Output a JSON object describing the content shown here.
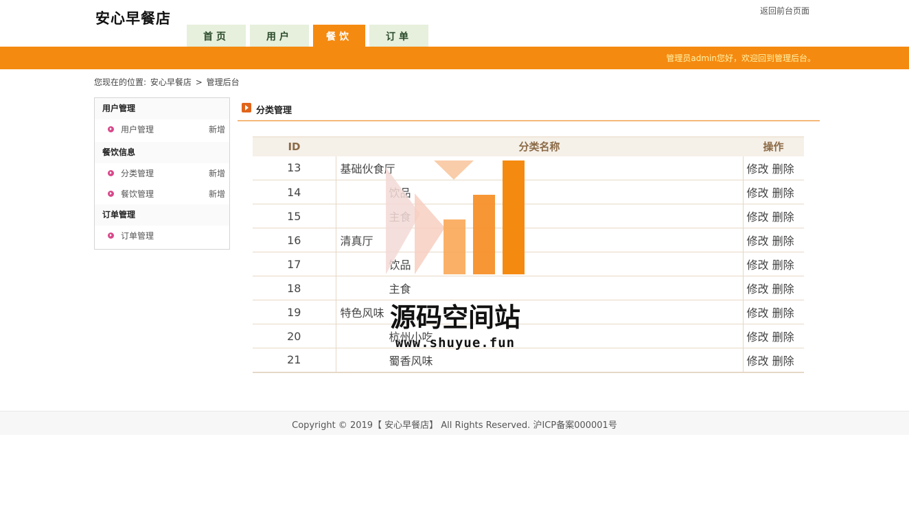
{
  "header": {
    "logo": "安心早餐店",
    "back_link": "返回前台页面",
    "welcome": "管理员admin您好，欢迎回到管理后台。"
  },
  "nav": {
    "tabs": [
      {
        "label": "首页",
        "active": false
      },
      {
        "label": "用户",
        "active": false
      },
      {
        "label": "餐饮",
        "active": true
      },
      {
        "label": "订单",
        "active": false
      }
    ]
  },
  "breadcrumb": {
    "prefix": "您现在的位置:",
    "site": "安心早餐店",
    "separator": ">",
    "current": "管理后台"
  },
  "sidebar": {
    "sections": [
      {
        "title": "用户管理",
        "items": [
          {
            "label": "用户管理",
            "action": "新增"
          }
        ]
      },
      {
        "title": "餐饮信息",
        "items": [
          {
            "label": "分类管理",
            "action": "新增"
          },
          {
            "label": "餐饮管理",
            "action": "新增"
          }
        ]
      },
      {
        "title": "订单管理",
        "items": [
          {
            "label": "订单管理",
            "action": ""
          }
        ]
      }
    ]
  },
  "panel": {
    "title": "分类管理"
  },
  "table": {
    "headers": [
      "ID",
      "分类名称",
      "操作"
    ],
    "edit_label": "修改",
    "delete_label": "删除",
    "rows": [
      {
        "id": "13",
        "name": "基础伙食厅",
        "child": false
      },
      {
        "id": "14",
        "name": "饮品",
        "child": true
      },
      {
        "id": "15",
        "name": "主食",
        "child": true
      },
      {
        "id": "16",
        "name": "清真厅",
        "child": false
      },
      {
        "id": "17",
        "name": "饮品",
        "child": true
      },
      {
        "id": "18",
        "name": "主食",
        "child": true
      },
      {
        "id": "19",
        "name": "特色风味",
        "child": false
      },
      {
        "id": "20",
        "name": "杭州小吃",
        "child": true
      },
      {
        "id": "21",
        "name": "蜀香风味",
        "child": true
      }
    ]
  },
  "watermark": {
    "text": "源码空间站",
    "url": "www.shuyue.fun"
  },
  "footer": {
    "copyright": "Copyright © 2019【 安心早餐店】 All Rights Reserved. 沪ICP备案000001号"
  },
  "colors": {
    "brand": "#f58a10",
    "nav_tab": "#e6f0dc",
    "welcome_text": "#fff3a8",
    "bullet": "#d9488b"
  }
}
